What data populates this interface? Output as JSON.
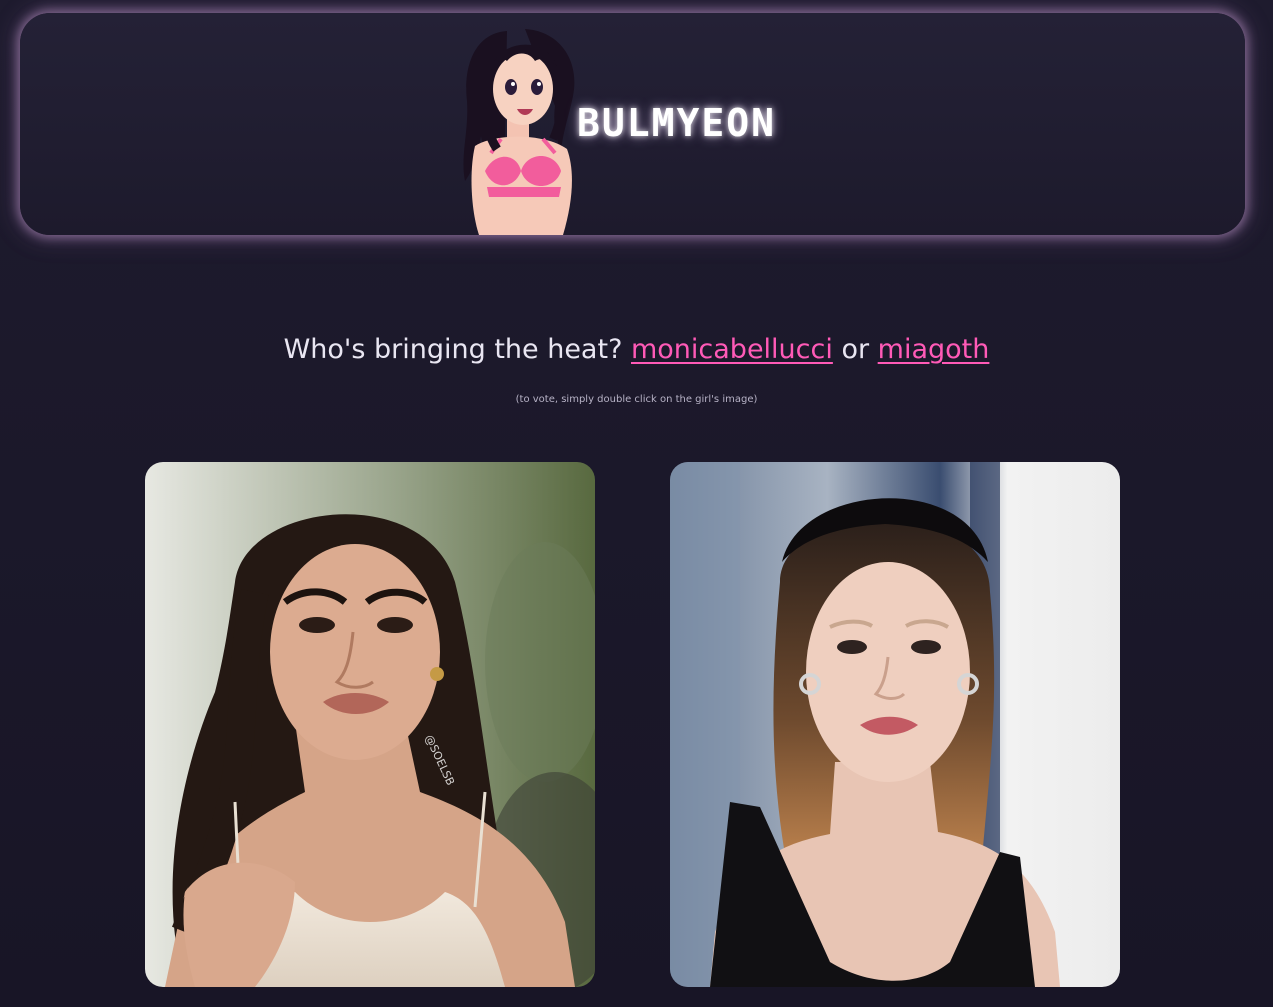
{
  "brand": {
    "name": "BULMYEON",
    "mascot_icon": "anime-girl-mascot-icon"
  },
  "prompt": {
    "prefix": "Who's bringing the heat? ",
    "option_a": "monicabellucci",
    "joiner": " or ",
    "option_b": "miagoth",
    "hint": "(to vote, simply double click on the girl's image)"
  },
  "cards": [
    {
      "name": "monicabellucci",
      "watermark": "@SOELSB"
    },
    {
      "name": "miagoth"
    }
  ],
  "colors": {
    "background": "#1b1829",
    "accent": "#ff5ab7",
    "glow": "#be96c8"
  }
}
